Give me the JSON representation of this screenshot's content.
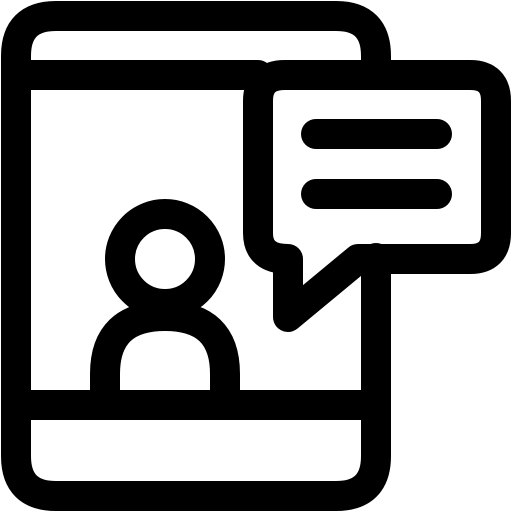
{
  "icon": {
    "name": "mobile-chat-icon",
    "parts": [
      "phone-icon",
      "user-icon",
      "chat-bubble-icon"
    ],
    "stroke_color": "#000000",
    "background_color": "#ffffff"
  }
}
